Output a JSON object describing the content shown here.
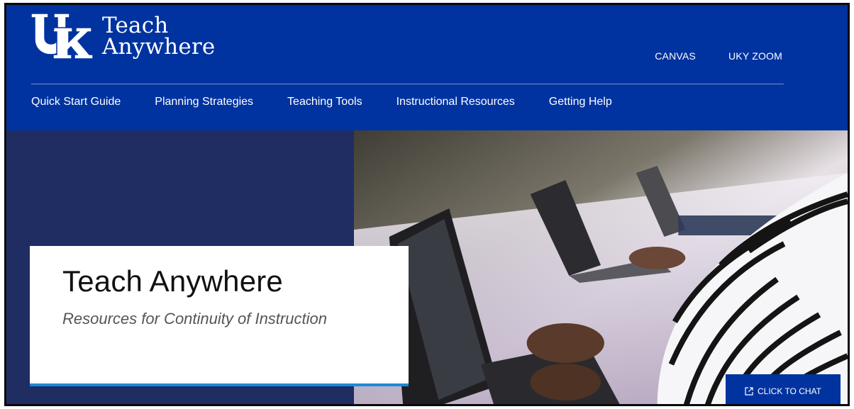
{
  "brand": {
    "logo_line1": "Teach",
    "logo_line2": "Anywhere",
    "color_primary": "#0033a0",
    "color_navy": "#1f2d63",
    "color_accent": "#1c8ad8"
  },
  "utility_nav": [
    {
      "label": "CANVAS"
    },
    {
      "label": "UKY ZOOM"
    }
  ],
  "main_nav": [
    {
      "label": "Quick Start Guide"
    },
    {
      "label": "Planning Strategies"
    },
    {
      "label": "Teaching Tools"
    },
    {
      "label": "Instructional Resources"
    },
    {
      "label": "Getting Help"
    }
  ],
  "hero": {
    "title": "Teach Anywhere",
    "subtitle": "Resources for Continuity of Instruction",
    "image": "students typing on laptops"
  },
  "chat": {
    "label": "CLICK TO CHAT",
    "icon": "external-link-icon"
  }
}
